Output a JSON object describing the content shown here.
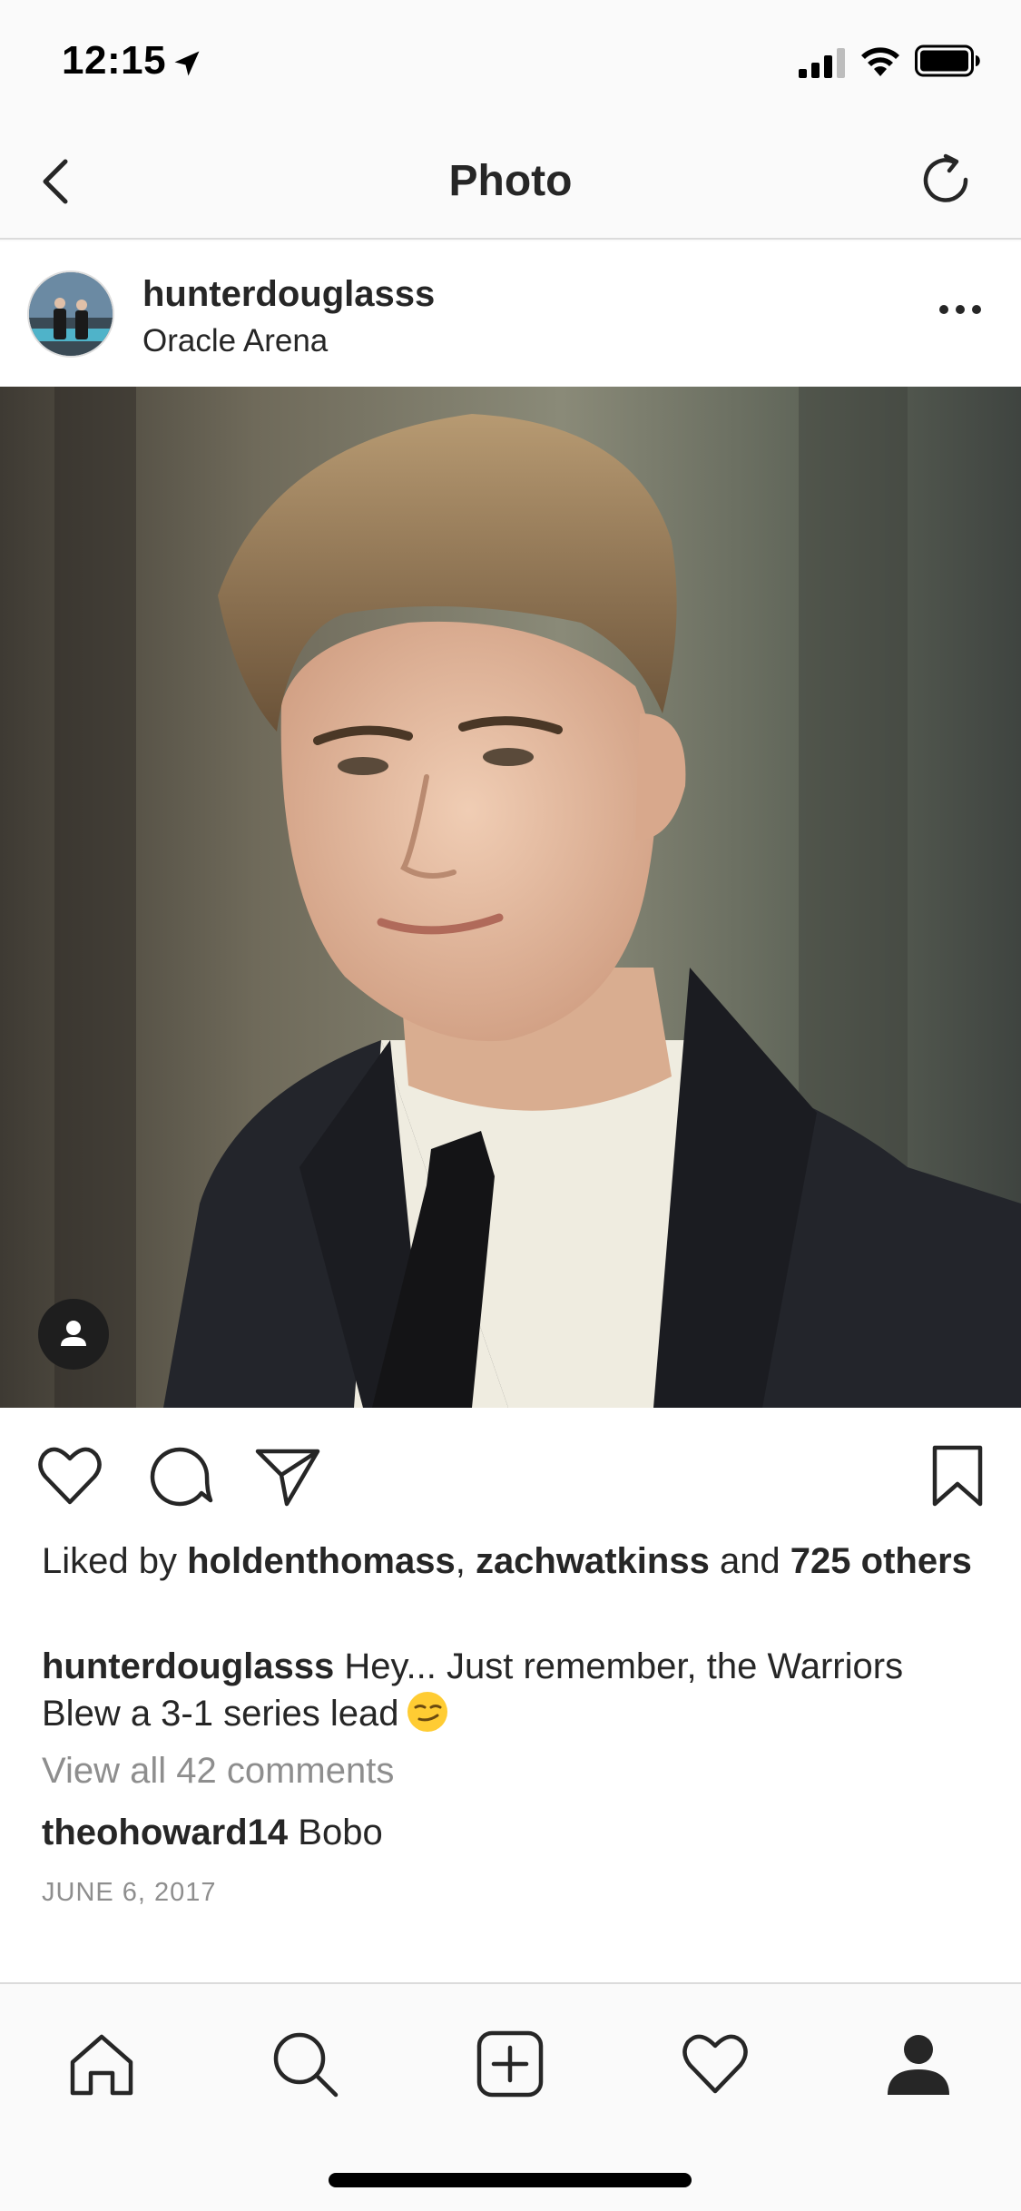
{
  "status_bar": {
    "time": "12:15"
  },
  "nav": {
    "title": "Photo"
  },
  "post": {
    "username": "hunterdouglasss",
    "location": "Oracle Arena",
    "likes": {
      "prefix": "Liked by ",
      "user1": "holdenthomass",
      "separator": ", ",
      "user2": "zachwatkinss",
      "middle": " and ",
      "count": "725 others"
    },
    "caption": {
      "username": "hunterdouglasss",
      "text": " Hey... Just remember, the Warriors Blew a 3-1 series lead"
    },
    "view_comments": "View all 42 comments",
    "comment": {
      "username": "theohoward14",
      "text": " Bobo"
    },
    "date": "JUNE 6, 2017"
  },
  "colors": {
    "text": "#262626",
    "secondary_text": "#8e8e8e",
    "divider": "#dbdbdb",
    "background": "#fafafa"
  },
  "icons": {
    "back": "chevron-left-icon",
    "refresh": "refresh-icon",
    "more": "more-horizontal-icon",
    "tag": "user-tag-icon",
    "like": "heart-icon",
    "comment": "comment-icon",
    "share": "send-icon",
    "save": "bookmark-icon",
    "home": "home-icon",
    "search": "search-icon",
    "add": "add-post-icon",
    "activity": "heart-icon",
    "profile": "profile-icon"
  }
}
